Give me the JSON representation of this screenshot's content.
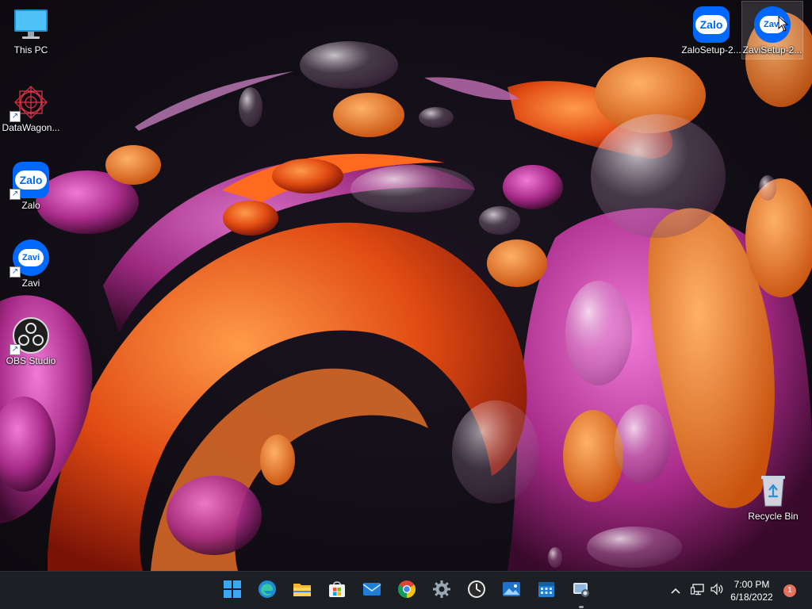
{
  "desktop": {
    "icons": [
      {
        "label": "This PC",
        "icon": "monitor-icon"
      },
      {
        "label": "DataWagon...",
        "icon": "datawagon-icon"
      },
      {
        "label": "Zalo",
        "icon": "zalo-icon",
        "glyph_text": "Zalo"
      },
      {
        "label": "Zavi",
        "icon": "zavi-icon",
        "glyph_text": "Zavi"
      },
      {
        "label": "OBS Studio",
        "icon": "obs-icon"
      },
      {
        "label": "ZaloSetup-2...",
        "icon": "zalo-setup-icon",
        "glyph_text": "Zalo"
      },
      {
        "label": "ZaviSetup-2...",
        "icon": "zavi-setup-icon",
        "glyph_text": "Zavi"
      },
      {
        "label": "Recycle Bin",
        "icon": "recycle-bin-icon"
      }
    ]
  },
  "taskbar": {
    "apps": [
      {
        "name": "Start",
        "icon": "windows-start-icon"
      },
      {
        "name": "Microsoft Edge",
        "icon": "edge-icon"
      },
      {
        "name": "File Explorer",
        "icon": "file-explorer-icon"
      },
      {
        "name": "Microsoft Store",
        "icon": "store-icon"
      },
      {
        "name": "Mail",
        "icon": "mail-icon"
      },
      {
        "name": "Google Chrome",
        "icon": "chrome-icon"
      },
      {
        "name": "Settings",
        "icon": "gear-icon"
      },
      {
        "name": "Clock",
        "icon": "clock-icon"
      },
      {
        "name": "Photos",
        "icon": "photos-icon"
      },
      {
        "name": "Calendar",
        "icon": "calendar-icon"
      },
      {
        "name": "Snipping Tool",
        "icon": "snipping-icon"
      }
    ],
    "tray": {
      "overflow_icon": "chevron-up-icon",
      "network_icon": "network-icon",
      "volume_icon": "volume-icon",
      "time": "7:00 PM",
      "date": "6/18/2022",
      "notification_count": "1"
    }
  },
  "colors": {
    "taskbar_bg": "#1c1f24",
    "zalo_blue": "#0068ff",
    "wallpaper_orange": "#f0661c",
    "wallpaper_magenta": "#c23a9e",
    "notification_badge": "#e9705a"
  }
}
